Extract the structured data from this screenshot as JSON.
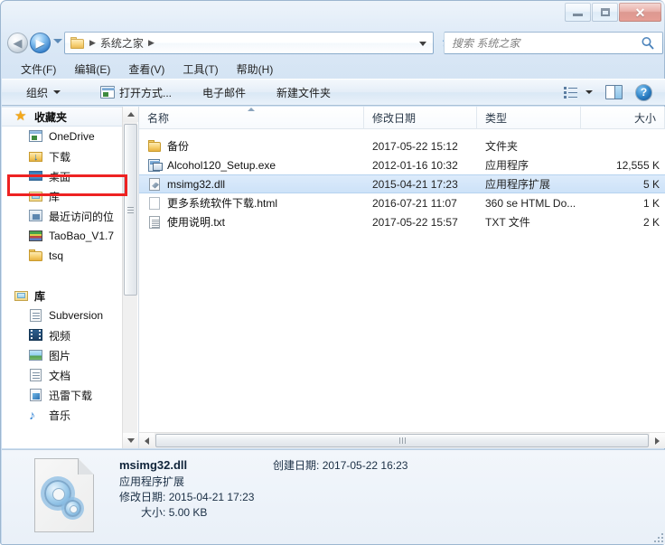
{
  "window": {
    "caption_buttons": {
      "minimize_label": "—",
      "maximize_label": "□",
      "close_label": "✕"
    }
  },
  "addressbar": {
    "back_glyph": "◀",
    "forward_glyph": "▶",
    "crumb_root_sep": "▶",
    "crumb": "系统之家",
    "crumb_tail_sep": "▶",
    "folder_icon": "folder-icon"
  },
  "search": {
    "placeholder": "搜索 系统之家",
    "icon": "search-icon"
  },
  "menubar": {
    "items": [
      {
        "label": "文件(F)"
      },
      {
        "label": "编辑(E)"
      },
      {
        "label": "查看(V)"
      },
      {
        "label": "工具(T)"
      },
      {
        "label": "帮助(H)"
      }
    ]
  },
  "toolbar": {
    "organize_label": "组织",
    "open_with_label": "打开方式...",
    "email_label": "电子邮件",
    "new_folder_label": "新建文件夹",
    "help_label": "?"
  },
  "sidebar": {
    "sections": [
      {
        "label": "收藏夹",
        "icon": "star-icon",
        "active": true,
        "items": [
          {
            "label": "OneDrive",
            "icon": "onedrive-icon"
          },
          {
            "label": "下载",
            "icon": "download-folder-icon"
          },
          {
            "label": "桌面",
            "icon": "desktop-icon"
          },
          {
            "label": "库",
            "icon": "library-icon"
          },
          {
            "label": "最近访问的位",
            "icon": "recent-places-icon"
          },
          {
            "label": "TaoBao_V1.7",
            "icon": "books-icon"
          },
          {
            "label": "tsq",
            "icon": "folder-icon"
          }
        ]
      },
      {
        "label": "库",
        "icon": "library-icon",
        "active": false,
        "items": [
          {
            "label": "Subversion",
            "icon": "document-icon"
          },
          {
            "label": "视频",
            "icon": "video-icon"
          },
          {
            "label": "图片",
            "icon": "picture-icon"
          },
          {
            "label": "文档",
            "icon": "document-icon"
          },
          {
            "label": "迅雷下载",
            "icon": "thunder-download-icon"
          },
          {
            "label": "音乐",
            "icon": "music-note-icon"
          }
        ]
      }
    ]
  },
  "filelist": {
    "columns": [
      {
        "label": "名称",
        "sorted": true
      },
      {
        "label": "修改日期",
        "sorted": false
      },
      {
        "label": "类型",
        "sorted": false
      },
      {
        "label": "大小",
        "sorted": false
      }
    ],
    "rows": [
      {
        "name": "备份",
        "modified": "2017-05-22 15:12",
        "type": "文件夹",
        "size": "",
        "icon": "folder-icon",
        "selected": false
      },
      {
        "name": "Alcohol120_Setup.exe",
        "modified": "2012-01-16 10:32",
        "type": "应用程序",
        "size": "12,555 K",
        "icon": "installer-icon",
        "selected": false
      },
      {
        "name": "msimg32.dll",
        "modified": "2015-04-21 17:23",
        "type": "应用程序扩展",
        "size": "5 K",
        "icon": "dll-icon",
        "selected": true
      },
      {
        "name": "更多系统软件下载.html",
        "modified": "2016-07-21 11:07",
        "type": "360 se HTML Do...",
        "size": "1 K",
        "icon": "html-file-icon",
        "selected": false
      },
      {
        "name": "使用说明.txt",
        "modified": "2017-05-22 15:57",
        "type": "TXT 文件",
        "size": "2 K",
        "icon": "text-file-icon",
        "selected": false
      }
    ]
  },
  "annotation": {
    "color": "#ee2222",
    "target": "msimg32.dll"
  },
  "details": {
    "icon": "dll-gear-icon",
    "title": "msimg32.dll",
    "type": "应用程序扩展",
    "modified_label": "修改日期:",
    "modified_value": "2015-04-21 17:23",
    "size_label": "大小:",
    "size_value": "5.00 KB",
    "created_label": "创建日期:",
    "created_value": "2017-05-22 16:23"
  }
}
